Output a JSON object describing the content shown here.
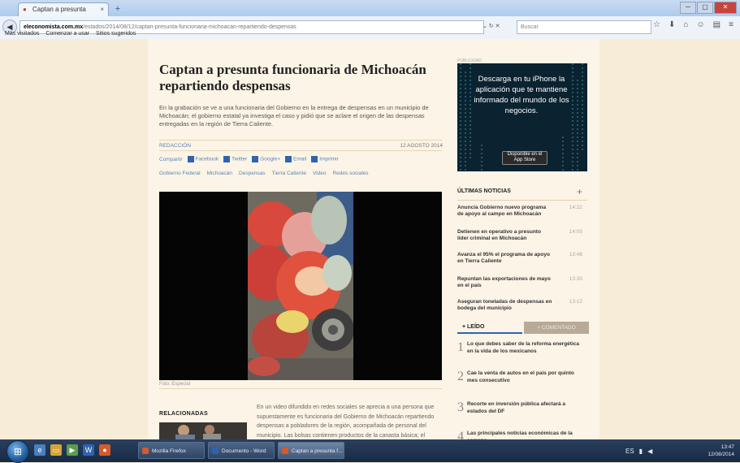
{
  "browser": {
    "tab_title": "Captan a presunta funcion…",
    "tab_close": "×",
    "new_tab": "+",
    "back": "◀",
    "url_domain": "eleconomista.com.mx",
    "url_path": "/estados/2014/08/12/captan-presunta-funcionaria-michoacan-repartiendo-despensas",
    "url_controls": "⌄ ↻ ✕",
    "search_placeholder": "Buscar",
    "tools": [
      "☆",
      "⬇",
      "⌂",
      "☺",
      "▤",
      "≡"
    ],
    "bookmarks": [
      "Más visitados",
      "Comenzar a usar",
      "Sitios sugeridos"
    ],
    "window_controls": [
      "─",
      "▢",
      "✕"
    ]
  },
  "article": {
    "headline": "Captan a presunta funcionaria de Michoacán repartiendo despensas",
    "dek": "En la grabación se ve a una funcionaria del Gobierno en la entrega de despensas en un municipio de Michoacán; el gobierno estatal ya investiga el caso y pidió que se aclare el origen de las despensas entregadas en la región de Tierra Caliente.",
    "byline": "REDACCIÓN",
    "date": "12 AGOSTO 2014",
    "share": [
      "Compartir",
      "Facebook",
      "Twitter",
      "Google+",
      "Email",
      "Imprimir"
    ],
    "tags": [
      "Gobierno Federal",
      "Michoacán",
      "Despensas",
      "Tierra Caliente",
      "Video",
      "Redes sociales"
    ],
    "caption": "Foto: Especial",
    "related_label": "RELACIONADAS",
    "body": "En un video difundido en redes sociales se aprecia a una persona que supuestamente es funcionaria del Gobierno de Michoacán repartiendo despensas a pobladores de la región, acompañada de personal del municipio. Las bolsas contienen productos de la canasta básica; el gobierno informó que se revisará el caso para deslindar responsabilidades."
  },
  "sidebar": {
    "ad_label": "PUBLICIDAD",
    "ad_text": "Descarga en tu iPhone la aplicación que te mantiene informado del mundo de los negocios.",
    "ad_button": "Disponible en el App Store",
    "latest_title": "ÚLTIMAS NOTICIAS",
    "latest_plus": "+",
    "latest": [
      {
        "title": "Anuncia Gobierno nuevo programa de apoyo al campo en Michoacán",
        "time": "14:22"
      },
      {
        "title": "Detienen en operativo a presunto líder criminal en Michoacán",
        "time": "14:05"
      },
      {
        "title": "Avanza el 95% el programa de apoyo en Tierra Caliente",
        "time": "13:48"
      },
      {
        "title": "Repuntan las exportaciones de mayo en el país",
        "time": "13:30"
      },
      {
        "title": "Aseguran toneladas de despensas en bodega del municipio",
        "time": "13:12"
      }
    ],
    "tab_read": "+ LEÍDO",
    "tab_commented": "+ COMENTADO",
    "most_read": [
      {
        "num": "1",
        "title": "Lo que debes saber de la reforma energética en la vida de los mexicanos"
      },
      {
        "num": "2",
        "title": "Cae la venta de autos en el país por quinto mes consecutivo"
      },
      {
        "num": "3",
        "title": "Recorte en inversión pública afectará a estados del DF"
      },
      {
        "num": "4",
        "title": "Las principales noticias económicas de la semana"
      }
    ]
  },
  "taskbar": {
    "start": "⊞",
    "windows": [
      "Mozilla Firefox",
      "Documento - Word",
      "Captan a presunta f..."
    ],
    "clock_time": "13:47",
    "clock_date": "12/08/2014",
    "lang": "ES"
  },
  "colors": {
    "accent": "#2d64b0",
    "page_bg": "#f6ecd8",
    "content_bg": "#fcf4e6"
  }
}
